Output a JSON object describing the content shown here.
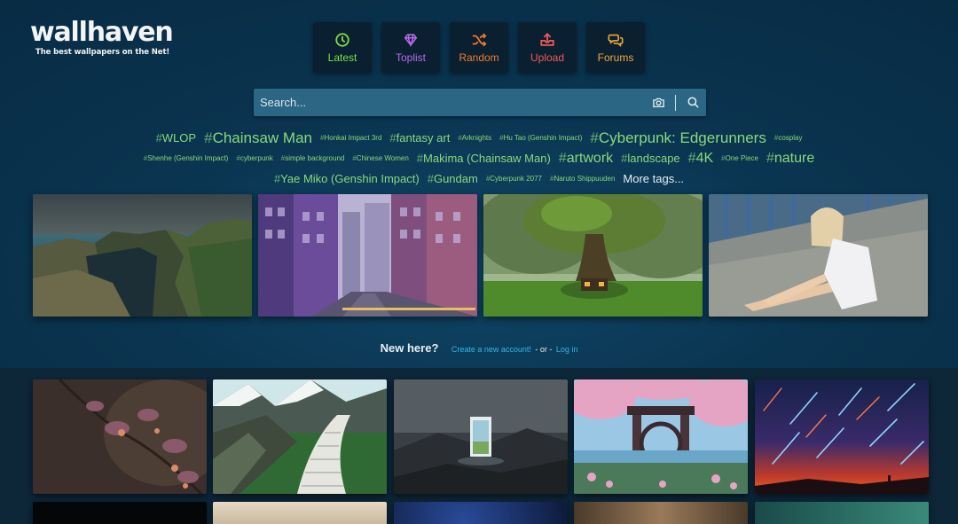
{
  "brand": {
    "name": "wallhaven",
    "tagline": "The best wallpapers on the Net!"
  },
  "nav": [
    {
      "label": "Latest",
      "icon": "clock-icon",
      "color": "#7de04a"
    },
    {
      "label": "Toplist",
      "icon": "diamond-icon",
      "color": "#b56be8"
    },
    {
      "label": "Random",
      "icon": "shuffle-icon",
      "color": "#f27a32"
    },
    {
      "label": "Upload",
      "icon": "upload-icon",
      "color": "#ec5a5a"
    },
    {
      "label": "Forums",
      "icon": "chat-bubbles-icon",
      "color": "#f1a73a"
    }
  ],
  "search": {
    "placeholder": "Search...",
    "value": ""
  },
  "tags": {
    "line1": [
      "WLOP",
      "Chainsaw Man",
      "Honkai Impact 3rd",
      "fantasy art",
      "Arknights",
      "Hu Tao (Genshin Impact)",
      "Cyberpunk: Edgerunners",
      "cosplay"
    ],
    "line2": [
      "Shenhe (Genshin Impact)",
      "cyberpunk",
      "simple background",
      "Chinese Women",
      "Makima (Chainsaw Man)",
      "artwork",
      "landscape",
      "4K",
      "One Piece",
      "nature"
    ],
    "line3": [
      "Yae Miko (Genshin Impact)",
      "Gundam",
      "Cyberpunk 2077",
      "Naruto Shippuuden"
    ],
    "more": "More tags..."
  },
  "featured": [
    {
      "subject": "sea cliffs landscape"
    },
    {
      "subject": "anime city street"
    },
    {
      "subject": "giant tree house"
    },
    {
      "subject": "woman on bridge"
    }
  ],
  "signup": {
    "question": "New here?",
    "create_link": "Create a new account!",
    "or": "- or -",
    "login_link": "Log in"
  },
  "grid": [
    {
      "subject": "flowers macro"
    },
    {
      "subject": "keyboard road mountains"
    },
    {
      "subject": "door in dark landscape"
    },
    {
      "subject": "pixel art shrine"
    },
    {
      "subject": "meteor shower sky"
    }
  ],
  "colors": {
    "tag": "#8bd87a",
    "link": "#36b6e6",
    "nav_bg": "#0a1f2f"
  }
}
